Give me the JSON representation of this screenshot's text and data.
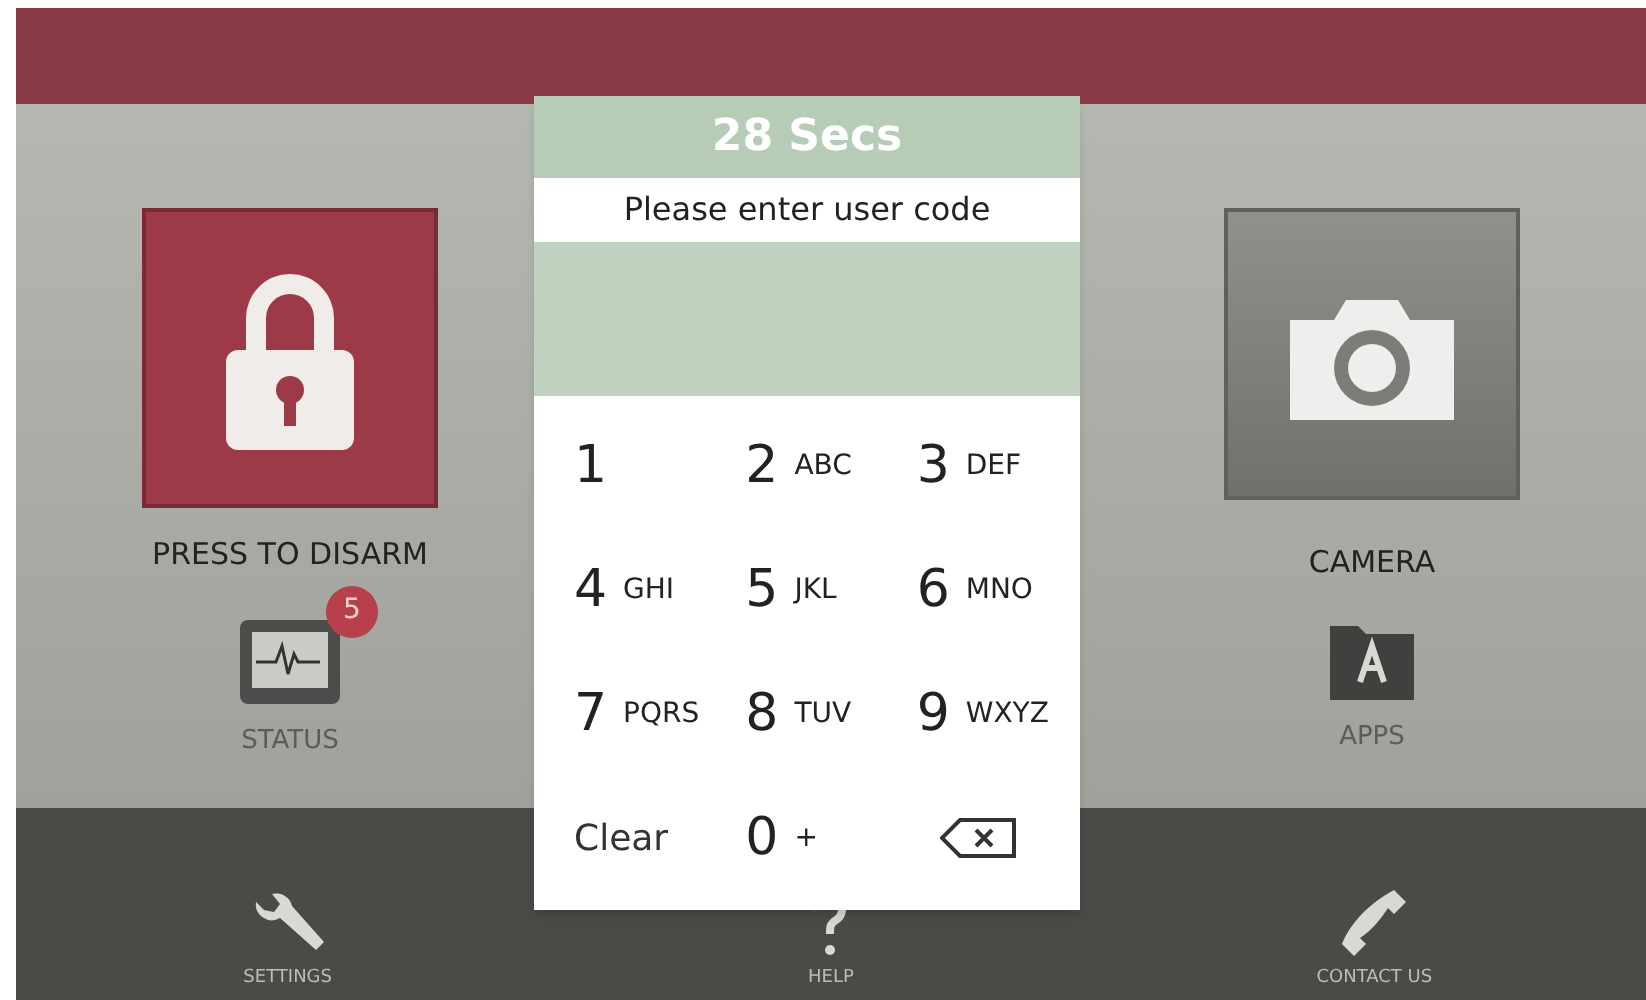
{
  "dialog": {
    "countdown": "28 Secs",
    "prompt": "Please enter user code",
    "keys": [
      {
        "kind": "digit",
        "digit": "1"
      },
      {
        "kind": "digit",
        "digit": "2",
        "letters": "ABC"
      },
      {
        "kind": "digit",
        "digit": "3",
        "letters": "DEF"
      },
      {
        "kind": "digit",
        "digit": "4",
        "letters": "GHI"
      },
      {
        "kind": "digit",
        "digit": "5",
        "letters": "JKL"
      },
      {
        "kind": "digit",
        "digit": "6",
        "letters": "MNO"
      },
      {
        "kind": "digit",
        "digit": "7",
        "letters": "PQRS"
      },
      {
        "kind": "digit",
        "digit": "8",
        "letters": "TUV"
      },
      {
        "kind": "digit",
        "digit": "9",
        "letters": "WXYZ"
      },
      {
        "kind": "clear",
        "label": "Clear"
      },
      {
        "kind": "digit",
        "digit": "0",
        "letters": "+"
      },
      {
        "kind": "backspace"
      }
    ]
  },
  "left": {
    "disarm_label": "PRESS TO DISARM",
    "status_label": "STATUS",
    "status_badge": "5"
  },
  "right": {
    "camera_label": "CAMERA",
    "apps_label": "APPS"
  },
  "bottom_bar": [
    {
      "kind": "settings",
      "label": "SETTINGS"
    },
    {
      "kind": "help",
      "label": "HELP"
    },
    {
      "kind": "contact",
      "label": "CONTACT US"
    }
  ]
}
